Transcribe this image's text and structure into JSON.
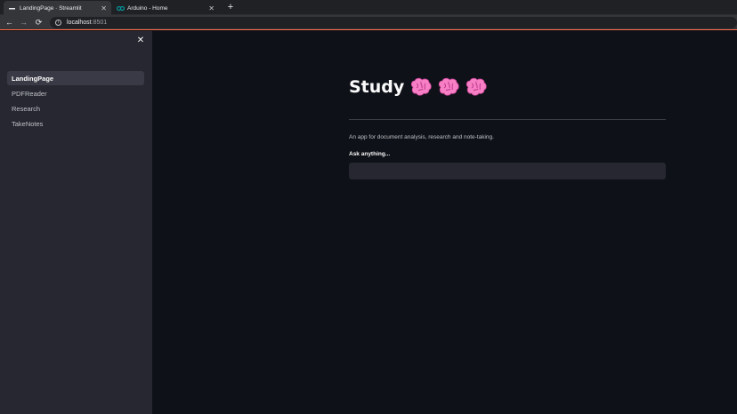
{
  "browser": {
    "tabs": [
      {
        "title": "LandingPage · Streamlit",
        "active": true
      },
      {
        "title": "Arduino - Home",
        "active": false
      }
    ],
    "address": {
      "host": "localhost",
      "port": ":8501"
    },
    "accent_color": "#ff6b4a"
  },
  "sidebar": {
    "items": [
      {
        "label": "LandingPage",
        "active": true
      },
      {
        "label": "PDFReader",
        "active": false
      },
      {
        "label": "Research",
        "active": false
      },
      {
        "label": "TakeNotes",
        "active": false
      }
    ]
  },
  "main": {
    "title": "Study",
    "title_icons": [
      "brain-icon",
      "brain-icon",
      "brain-icon"
    ],
    "description": "An app for document analysis, research and note-taking.",
    "ask_label": "Ask anything...",
    "ask_value": ""
  }
}
